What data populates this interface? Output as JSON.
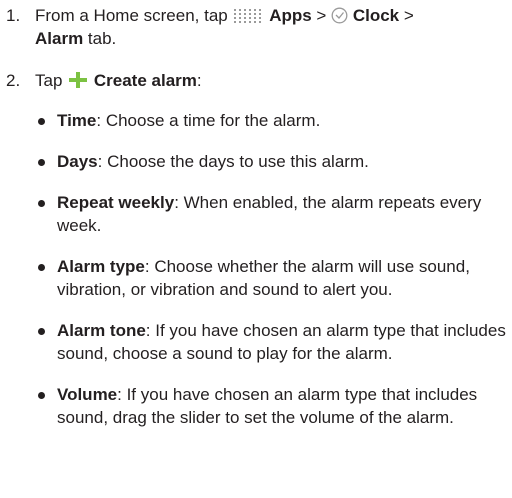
{
  "steps": [
    {
      "number": "1.",
      "prefix": "From a Home screen, tap ",
      "apps_label": "Apps",
      "sep1": " > ",
      "clock_label": "Clock",
      "sep2": " >",
      "alarm_label": "Alarm",
      "suffix": " tab."
    },
    {
      "number": "2.",
      "prefix": "Tap ",
      "create_label": "Create alarm",
      "suffix": ":"
    }
  ],
  "bullets": [
    {
      "term": "Time",
      "desc": ": Choose a time for the alarm."
    },
    {
      "term": "Days",
      "desc": ": Choose the days to use this alarm."
    },
    {
      "term": "Repeat weekly",
      "desc": ": When enabled, the alarm repeats every week."
    },
    {
      "term": "Alarm type",
      "desc": ": Choose whether the alarm will use sound, vibration, or vibration and sound to alert you."
    },
    {
      "term": "Alarm tone",
      "desc": ": If you have chosen an alarm type that includes sound, choose a sound to play for the alarm."
    },
    {
      "term": "Volume",
      "desc": ": If you have chosen an alarm type that includes sound, drag the slider to set the volume of the alarm."
    }
  ],
  "colors": {
    "text": "#231f20",
    "plus_icon": "#7cc242",
    "icon_gray": "#9a9a9a"
  },
  "icons": {
    "apps": "apps-grid-icon",
    "clock": "clock-icon",
    "create": "plus-icon"
  }
}
